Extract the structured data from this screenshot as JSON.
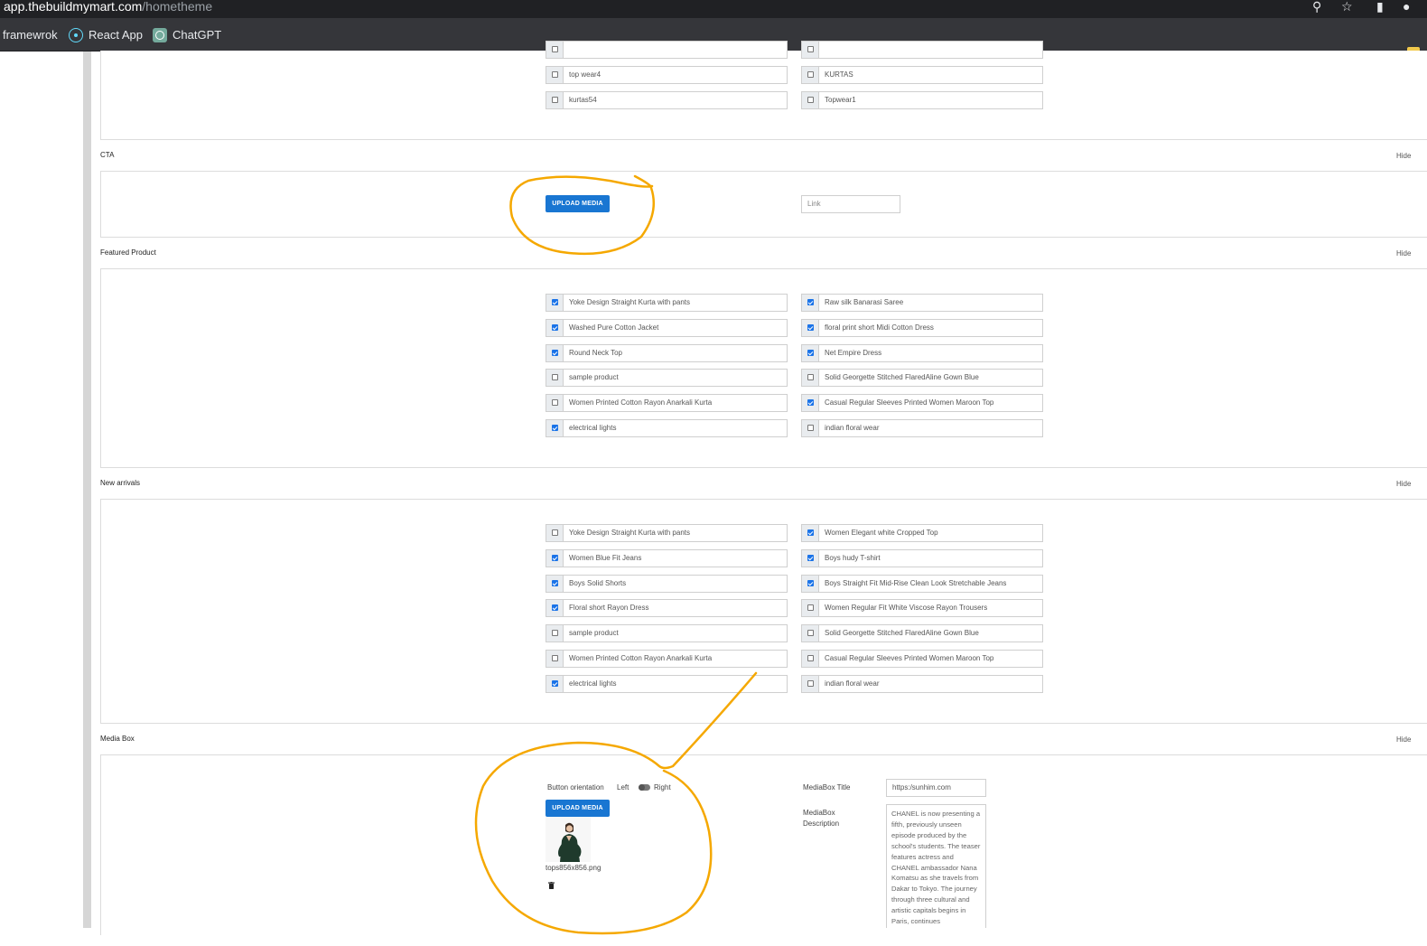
{
  "browser": {
    "url_host": "app.thebuildmymart.com",
    "url_path": "/hometheme",
    "bookmarks": [
      {
        "label": "framewrok"
      },
      {
        "label": "React App"
      },
      {
        "label": "ChatGPT"
      }
    ]
  },
  "hide_label": "Hide",
  "top_categories": {
    "items": [
      {
        "label": "top wear4",
        "checked": false
      },
      {
        "label": "KURTAS",
        "checked": false
      },
      {
        "label": "kurtas54",
        "checked": false
      },
      {
        "label": "Topwear1",
        "checked": false
      }
    ]
  },
  "cta": {
    "label": "CTA",
    "upload_label": "UPLOAD MEDIA",
    "link_placeholder": "Link"
  },
  "featured": {
    "label": "Featured Product",
    "items": [
      {
        "label": "Yoke Design Straight Kurta with pants",
        "checked": true
      },
      {
        "label": "Raw silk Banarasi Saree",
        "checked": true
      },
      {
        "label": "Washed Pure Cotton Jacket",
        "checked": true
      },
      {
        "label": "floral print short Midi Cotton Dress",
        "checked": true
      },
      {
        "label": "Round Neck Top",
        "checked": true
      },
      {
        "label": "Net Empire Dress",
        "checked": true
      },
      {
        "label": "sample product",
        "checked": false
      },
      {
        "label": "Solid Georgette Stitched FlaredAline Gown  Blue",
        "checked": false
      },
      {
        "label": "Women Printed Cotton Rayon Anarkali Kurta",
        "checked": false
      },
      {
        "label": "Casual Regular Sleeves Printed Women Maroon Top",
        "checked": true
      },
      {
        "label": "electrical lights",
        "checked": true
      },
      {
        "label": "indian floral wear",
        "checked": false
      }
    ]
  },
  "new_arrivals": {
    "label": "New arrivals",
    "items": [
      {
        "label": "Yoke Design Straight Kurta with pants",
        "checked": false
      },
      {
        "label": "Women Elegant white Cropped Top",
        "checked": true
      },
      {
        "label": "Women Blue  Fit Jeans",
        "checked": true
      },
      {
        "label": "Boys hudy T-shirt",
        "checked": true
      },
      {
        "label": "Boys Solid Shorts",
        "checked": true
      },
      {
        "label": "Boys Straight Fit Mid-Rise Clean Look Stretchable Jeans",
        "checked": true
      },
      {
        "label": "Floral short Rayon Dress",
        "checked": true
      },
      {
        "label": "Women Regular Fit White Viscose Rayon Trousers",
        "checked": false
      },
      {
        "label": "sample product",
        "checked": false
      },
      {
        "label": "Solid Georgette Stitched FlaredAline Gown  Blue",
        "checked": false
      },
      {
        "label": "Women Printed Cotton Rayon Anarkali Kurta",
        "checked": false
      },
      {
        "label": "Casual Regular Sleeves Printed Women Maroon Top",
        "checked": false
      },
      {
        "label": "electrical lights",
        "checked": true
      },
      {
        "label": "indian floral wear",
        "checked": false
      }
    ]
  },
  "media_box": {
    "label": "Media Box",
    "orientation_label": "Button orientation",
    "left_label": "Left",
    "right_label": "Right",
    "upload_label": "UPLOAD MEDIA",
    "file_name": "tops856x856.png",
    "title_label": "MediaBox Title",
    "title_value": "https:/sunhim.com",
    "description_label_1": "MediaBox",
    "description_label_2": "Description",
    "description_value": "CHANEL is now presenting a fifth, previously unseen episode produced by the school's students. The teaser features actress and CHANEL ambassador Nana Komatsu as she travels from Dakar to Tokyo. The journey through three cultural and artistic capitals begins in Paris, continues"
  },
  "colors": {
    "primary": "#1976d2",
    "annotation": "#f5a800"
  }
}
